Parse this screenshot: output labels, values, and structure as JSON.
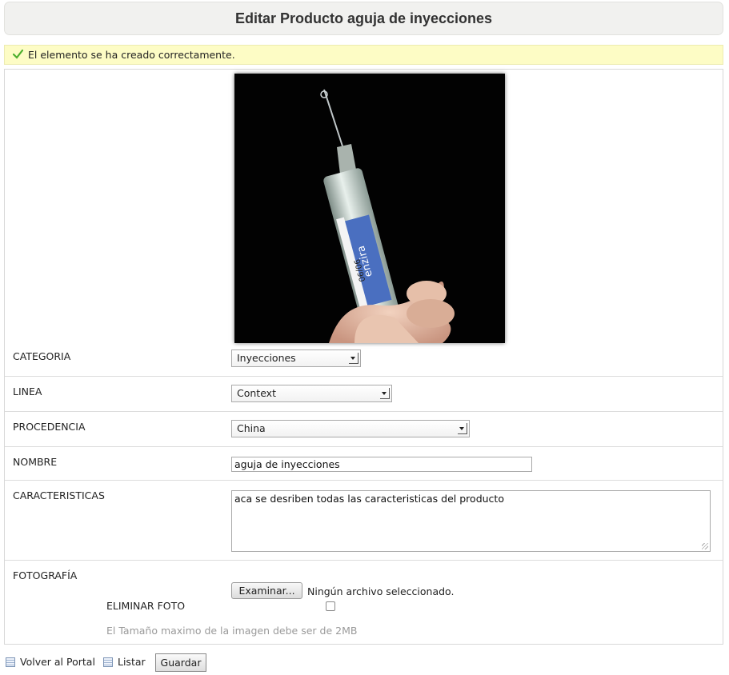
{
  "page": {
    "title": "Editar Producto aguja de inyecciones"
  },
  "notice": {
    "message": "El elemento se ha creado correctamente."
  },
  "form": {
    "categoria": {
      "label": "CATEGORIA",
      "value": "Inyecciones"
    },
    "linea": {
      "label": "LINEA",
      "value": "Context"
    },
    "procedencia": {
      "label": "PROCEDENCIA",
      "value": "China"
    },
    "nombre": {
      "label": "NOMBRE",
      "value": "aguja de inyecciones"
    },
    "caracteristicas": {
      "label": "CARACTERISTICAS",
      "value": "aca se desriben todas las caracteristicas del producto"
    },
    "fotografia": {
      "label": "FOTOGRAFÍA",
      "browse_label": "Examinar...",
      "file_status": "Ningún archivo seleccionado.",
      "delete_label": "ELIMINAR FOTO",
      "hint": "El Tamaño maximo de la imagen debe ser de 2MB"
    }
  },
  "photo_text": {
    "label_line1": "enzira",
    "label_line2": "90/90"
  },
  "footer": {
    "back_label": "Volver al Portal",
    "list_label": "Listar",
    "save_label": "Guardar"
  },
  "colors": {
    "notice_bg": "#fdfcc5",
    "title_bg": "#f1f1ef",
    "check_green": "#4caf2d"
  }
}
